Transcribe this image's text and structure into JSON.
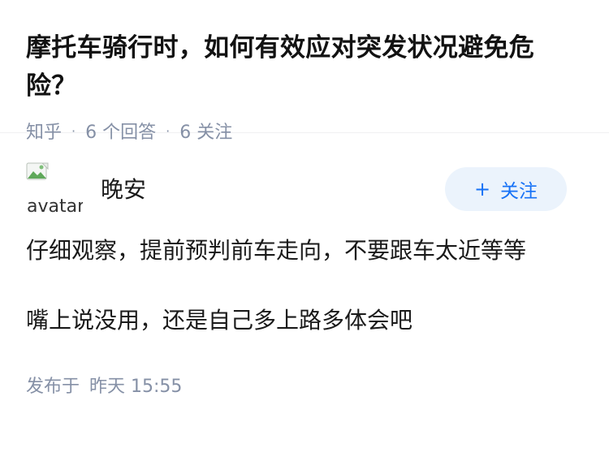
{
  "question": {
    "title": "摩托车骑行时，如何有效应对突发状况避免危险？",
    "source": "知乎",
    "answer_count": "6 个回答",
    "follow_count": "6 关注"
  },
  "answer": {
    "avatar_alt": "avatar",
    "author_name": "晚安",
    "follow_button": {
      "icon": "plus-icon",
      "label": "关注"
    },
    "paragraphs": [
      "仔细观察，提前预判前车走向，不要跟车太近等等",
      "嘴上说没用，还是自己多上路多体会吧"
    ],
    "publish": {
      "label": "发布于",
      "time": "昨天 15:55"
    }
  },
  "colors": {
    "accent": "#1772f6",
    "follow_bg": "#ebf3fc",
    "meta_gray": "#8590a6"
  }
}
